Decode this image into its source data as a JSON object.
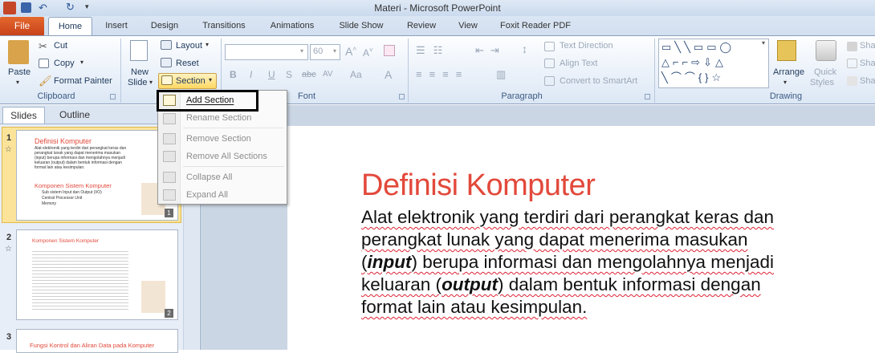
{
  "window": {
    "title": "Materi  -  Microsoft PowerPoint"
  },
  "ribbon_tabs": [
    "File",
    "Home",
    "Insert",
    "Design",
    "Transitions",
    "Animations",
    "Slide Show",
    "Review",
    "View",
    "Foxit Reader PDF"
  ],
  "clipboard": {
    "paste": "Paste",
    "cut": "Cut",
    "copy": "Copy",
    "format_painter": "Format Painter",
    "group": "Clipboard"
  },
  "slides_group": {
    "new_slide": "New",
    "new_slide2": "Slide",
    "layout": "Layout",
    "reset": "Reset",
    "section": "Section"
  },
  "font": {
    "size": "60",
    "group": "Font",
    "bold": "B",
    "italic": "I",
    "underline": "U",
    "strike": "S",
    "abc": "abc",
    "spacing": "AV",
    "aa": "Aa",
    "a": "A"
  },
  "paragraph": {
    "text_direction": "Text Direction",
    "align_text": "Align Text",
    "convert": "Convert to SmartArt",
    "group": "Paragraph"
  },
  "drawing": {
    "arrange": "Arrange",
    "quick": "Quick",
    "styles": "Styles",
    "shape1": "Sha",
    "shape2": "Sha",
    "shape3": "Sha",
    "group": "Drawing"
  },
  "panel": {
    "tab_slides": "Slides",
    "tab_outline": "Outline"
  },
  "section_menu": {
    "items": [
      "Add Section",
      "Rename Section",
      "Remove Section",
      "Remove All Sections",
      "Collapse All",
      "Expand All"
    ]
  },
  "thumbnails": [
    {
      "num": "1",
      "badge": "1",
      "title": "Definisi Komputer",
      "sub": "Komponen Sistem Komputer",
      "lines": [
        "Alat elektronik yang terdiri dari perangkat keras dan",
        "perangkat lunak yang dapat menerima masukan",
        "(input) berupa informasi dan mengolahnya menjadi",
        "keluaran (output) dalam bentuk informasi dengan",
        "format lain atau kesimpulan."
      ],
      "bullets": [
        "Sub sistem Input dan Output (I/O)",
        "Central Processor Unit",
        "Memory"
      ]
    },
    {
      "num": "2",
      "badge": "2",
      "title": "Komponen Sistem Komputer"
    },
    {
      "num": "3",
      "title": "Fungsi Kontrol dan Aliran Data pada Komputer"
    }
  ],
  "slide": {
    "title": "Definisi Komputer",
    "l1": "Alat elektronik yang terdiri dari perangkat keras dan",
    "l2": "perangkat lunak yang dapat menerima masukan",
    "l3a": "(",
    "l3b": "input",
    "l3c": ") berupa informasi dan mengolahnya menjadi",
    "l4a": "keluaran (",
    "l4b": "output",
    "l4c": ") dalam bentuk informasi dengan",
    "l5": "format lain atau kesimpulan."
  },
  "colors": {
    "accent": "#e2493b",
    "file_tab": "#d05426",
    "section_highlight": "#ffe27a"
  }
}
